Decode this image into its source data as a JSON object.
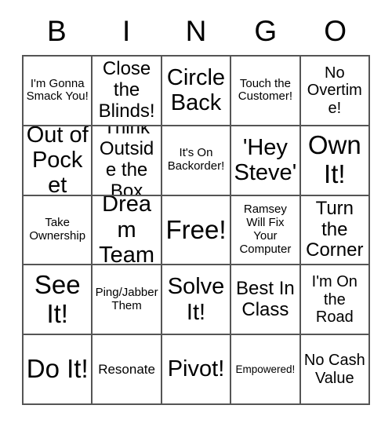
{
  "card": {
    "title": "BINGO",
    "headers": [
      "B",
      "I",
      "N",
      "G",
      "O"
    ],
    "grid_colors": {
      "border": "#555555",
      "cell_background": "#ffffff",
      "text": "#000000"
    },
    "rows": [
      [
        {
          "text": "I'm Gonna Smack You!",
          "size": "sz-sm",
          "free": false
        },
        {
          "text": "Close the Blinds!",
          "size": "sz-xl",
          "free": false
        },
        {
          "text": "Circle Back",
          "size": "sz-xxl",
          "free": false
        },
        {
          "text": "Touch the Customer!",
          "size": "sz-sm",
          "free": false
        },
        {
          "text": "No Overtime!",
          "size": "sz-lg",
          "free": false
        }
      ],
      [
        {
          "text": "Out of Pocket",
          "size": "sz-xxl",
          "free": false
        },
        {
          "text": "Think Outside the Box",
          "size": "sz-xl",
          "free": false
        },
        {
          "text": "It's On Backorder!",
          "size": "sz-sm",
          "free": false
        },
        {
          "text": "'Hey Steve'",
          "size": "sz-xxl",
          "free": false
        },
        {
          "text": "Own It!",
          "size": "sz-max",
          "free": false
        }
      ],
      [
        {
          "text": "Take Ownership",
          "size": "sz-sm",
          "free": false
        },
        {
          "text": "Dream Team",
          "size": "sz-xxl",
          "free": false
        },
        {
          "text": "Free!",
          "size": "sz-max",
          "free": true
        },
        {
          "text": "Ramsey Will Fix Your Computer",
          "size": "sz-sm",
          "free": false
        },
        {
          "text": "Turn the Corner",
          "size": "sz-xl",
          "free": false
        }
      ],
      [
        {
          "text": "See It!",
          "size": "sz-max",
          "free": false
        },
        {
          "text": "Ping/Jabber Them",
          "size": "sz-sm",
          "free": false
        },
        {
          "text": "Solve It!",
          "size": "sz-xxl",
          "free": false
        },
        {
          "text": "Best In Class",
          "size": "sz-xl",
          "free": false
        },
        {
          "text": "I'm On the Road",
          "size": "sz-lg",
          "free": false
        }
      ],
      [
        {
          "text": "Do It!",
          "size": "sz-max",
          "free": false
        },
        {
          "text": "Resonate",
          "size": "sz-md",
          "free": false
        },
        {
          "text": "Pivot!",
          "size": "sz-xxl",
          "free": false
        },
        {
          "text": "Empowered!",
          "size": "sz-xs",
          "free": false
        },
        {
          "text": "No Cash Value",
          "size": "sz-lg",
          "free": false
        }
      ]
    ]
  }
}
